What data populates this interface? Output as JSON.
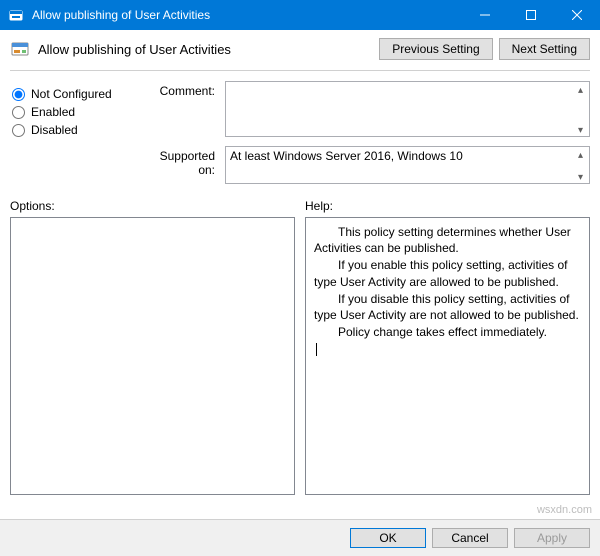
{
  "window": {
    "title": "Allow publishing of User Activities"
  },
  "subheader": {
    "title": "Allow publishing of User Activities",
    "prev_setting": "Previous Setting",
    "next_setting": "Next Setting"
  },
  "state_radios": {
    "not_configured": "Not Configured",
    "enabled": "Enabled",
    "disabled": "Disabled",
    "selected": "not_configured"
  },
  "fields": {
    "comment_label": "Comment:",
    "comment_value": "",
    "supported_label": "Supported on:",
    "supported_value": "At least Windows Server 2016, Windows 10"
  },
  "panels": {
    "options_label": "Options:",
    "help_label": "Help:"
  },
  "help": {
    "p1": "This policy setting determines whether User Activities can be published.",
    "p2": "If you enable this policy setting, activities of type User Activity are allowed to be published.",
    "p3": "If you disable this policy setting, activities of type User Activity are not allowed to be published.",
    "p4": "Policy change takes effect immediately."
  },
  "footer": {
    "ok": "OK",
    "cancel": "Cancel",
    "apply": "Apply"
  },
  "watermark": "wsxdn.com"
}
